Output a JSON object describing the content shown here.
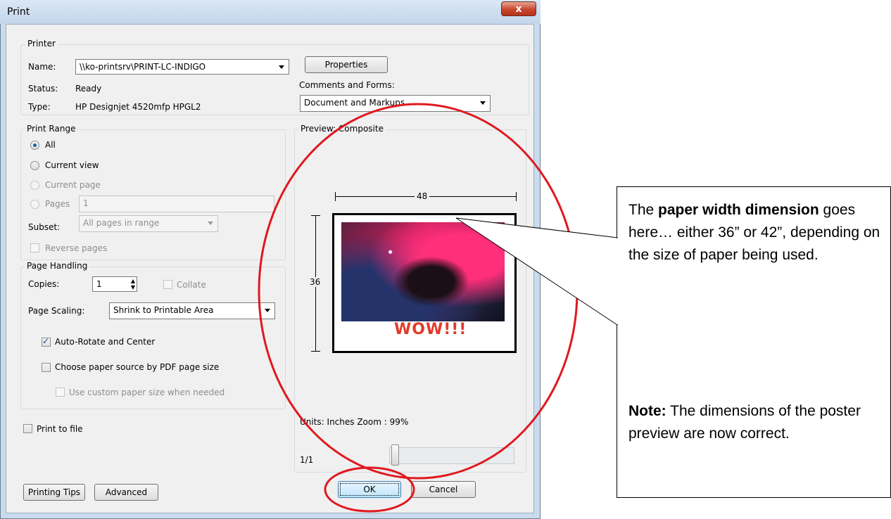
{
  "window": {
    "title": "Print",
    "close_glyph": "x"
  },
  "printer": {
    "group_label": "Printer",
    "name_label": "Name:",
    "name_value": "\\\\ko-printsrv\\PRINT-LC-INDIGO",
    "status_label": "Status:",
    "status_value": "Ready",
    "type_label": "Type:",
    "type_value": "HP Designjet 4520mfp HPGL2",
    "properties_button": "Properties",
    "comments_label": "Comments and Forms:",
    "comments_value": "Document and Markups"
  },
  "print_range": {
    "group_label": "Print Range",
    "options": [
      {
        "label": "All",
        "selected": true,
        "enabled": true
      },
      {
        "label": "Current view",
        "selected": false,
        "enabled": true
      },
      {
        "label": "Current page",
        "selected": false,
        "enabled": false
      },
      {
        "label": "Pages",
        "selected": false,
        "enabled": false
      }
    ],
    "pages_value": "1",
    "subset_label": "Subset:",
    "subset_value": "All pages in range",
    "reverse_pages": "Reverse pages"
  },
  "page_handling": {
    "group_label": "Page Handling",
    "copies_label": "Copies:",
    "copies_value": "1",
    "collate": "Collate",
    "scaling_label": "Page Scaling:",
    "scaling_value": "Shrink to Printable Area",
    "auto_rotate": "Auto-Rotate and Center",
    "auto_rotate_checked": true,
    "choose_source": "Choose paper source by PDF page size",
    "custom_paper": "Use custom paper size when needed"
  },
  "print_to_file": "Print to file",
  "preview": {
    "group_label": "Preview: Composite",
    "width_dim": "48",
    "height_dim": "36",
    "caption": "WOW!!!",
    "units_zoom": "Units: Inches Zoom :  99%",
    "page_counter": "1/1"
  },
  "buttons": {
    "printing_tips": "Printing Tips",
    "advanced": "Advanced",
    "ok": "OK",
    "cancel": "Cancel"
  },
  "callout": {
    "part1": "The ",
    "bold1": "paper width dimension",
    "part2": " goes here…  either 36” or 42”, depending on the size of paper being used.",
    "note_label": "Note:",
    "note_text": " The dimensions of the poster preview are now correct."
  },
  "colors": {
    "annotation_red": "#e0181f",
    "selection_blue": "#1c5fb1"
  }
}
